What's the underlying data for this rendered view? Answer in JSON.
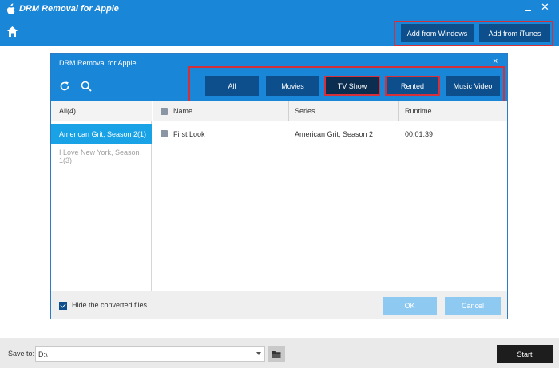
{
  "app": {
    "title": "DRM Removal for Apple",
    "icons": {
      "logo": "apple-logo-icon",
      "minimize": "minimize-icon",
      "close": "close-icon",
      "home": "home-icon"
    },
    "close_glyph": "✕"
  },
  "toolbar": {
    "add_from_windows": "Add from Windows",
    "add_from_itunes": "Add from iTunes"
  },
  "dialog": {
    "title": "DRM Removal for Apple",
    "close_glyph": "×",
    "icons": {
      "refresh": "refresh-icon",
      "search": "search-icon"
    },
    "filters": [
      {
        "label": "All",
        "selected": false
      },
      {
        "label": "Movies",
        "selected": false
      },
      {
        "label": "TV Show",
        "selected": true
      },
      {
        "label": "Rented",
        "selected": false
      },
      {
        "label": "Music Video",
        "selected": false
      }
    ],
    "sidebar": {
      "items": [
        {
          "label": "All(4)",
          "state": "normal"
        },
        {
          "label": "American Grit, Season 2(1)",
          "state": "selected"
        },
        {
          "label": "I Love New York, Season 1(3)",
          "state": "disabled"
        }
      ]
    },
    "table": {
      "columns": [
        "Name",
        "Series",
        "Runtime"
      ],
      "rows": [
        {
          "name": "First Look",
          "series": "American Grit, Season 2",
          "runtime": "00:01:39",
          "checked": false
        }
      ]
    },
    "footer": {
      "hide_converted_label": "Hide the converted files",
      "hide_converted_checked": true,
      "ok_label": "OK",
      "cancel_label": "Cancel"
    }
  },
  "bottom": {
    "save_to_label": "Save to:",
    "path_value": "D:\\",
    "start_label": "Start"
  },
  "colors": {
    "header_blue": "#1a86d8",
    "dark_button": "#0d4f8c",
    "highlight_red": "#d5303a",
    "selected_row": "#1aa2e6",
    "disabled_button": "#8ec9f2",
    "start_button": "#1d1d1d"
  }
}
